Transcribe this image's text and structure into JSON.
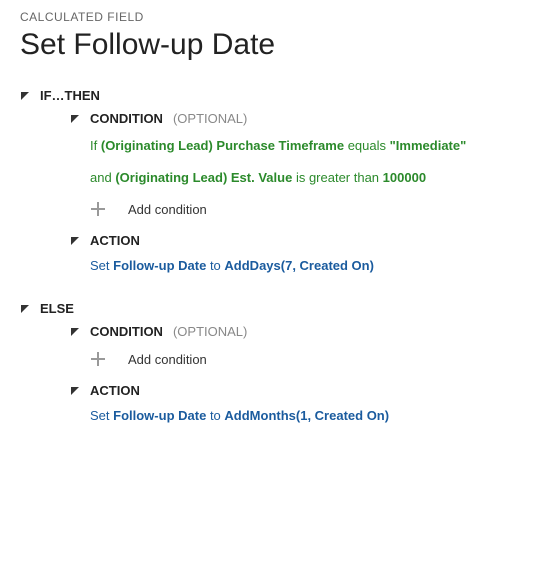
{
  "header": {
    "eyebrow": "CALCULATED FIELD",
    "title": "Set Follow-up Date"
  },
  "ifthen": {
    "label": "IF…THEN",
    "condition": {
      "label": "CONDITION",
      "optional": "(OPTIONAL)",
      "line1": {
        "prefix": "If",
        "field": "(Originating Lead) Purchase Timeframe",
        "op": "equals",
        "value": "\"Immediate\""
      },
      "line2": {
        "prefix": "and",
        "field": "(Originating Lead) Est. Value",
        "op": "is greater than",
        "value": "100000"
      },
      "add_label": "Add condition"
    },
    "action": {
      "label": "ACTION",
      "set": "Set",
      "field": "Follow-up Date",
      "to": "to",
      "func": "AddDays(7, Created On)"
    }
  },
  "else": {
    "label": "ELSE",
    "condition": {
      "label": "CONDITION",
      "optional": "(OPTIONAL)",
      "add_label": "Add condition"
    },
    "action": {
      "label": "ACTION",
      "set": "Set",
      "field": "Follow-up Date",
      "to": "to",
      "func": "AddMonths(1, Created On)"
    }
  }
}
